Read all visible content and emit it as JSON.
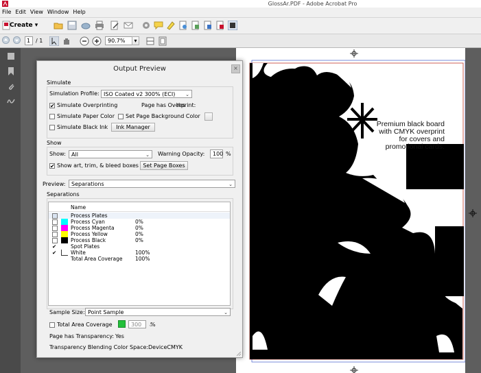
{
  "window": {
    "title": "GlossAr.PDF - Adobe Acrobat Pro"
  },
  "menu": [
    "File",
    "Edit",
    "View",
    "Window",
    "Help"
  ],
  "toolbar": {
    "create_label": "Create",
    "page_current": "1",
    "page_total": "/ 1",
    "zoom_value": "90.7%"
  },
  "document": {
    "text": "Premium black board\nwith CMYK overprint\nfor covers and\npromotional cards."
  },
  "dialog": {
    "title": "Output Preview",
    "close_symbol": "×",
    "simulate": {
      "group_label": "Simulate",
      "profile_label": "Simulation Profile:",
      "profile_value": "ISO Coated v2 300% (ECI)",
      "overprinting_label": "Simulate Overprinting",
      "page_has_overprint_label": "Page has Overprint:",
      "page_has_overprint_value": "Yes",
      "paper_color_label": "Simulate Paper Color",
      "bg_color_label": "Set Page Background Color",
      "black_ink_label": "Simulate Black Ink",
      "ink_manager_label": "Ink Manager"
    },
    "show": {
      "group_label": "Show",
      "show_label": "Show:",
      "show_value": "All",
      "warning_opacity_label": "Warning Opacity:",
      "warning_opacity_value": "100",
      "percent": "%",
      "boxes_label": "Show art, trim, & bleed boxes",
      "set_page_boxes_label": "Set Page Boxes"
    },
    "preview": {
      "label": "Preview:",
      "value": "Separations"
    },
    "separations": {
      "group_label": "Separations",
      "column_name": "Name",
      "rows": [
        {
          "check": "",
          "name": "Process Plates",
          "pct": "",
          "color": ""
        },
        {
          "check": "",
          "name": "Process Cyan",
          "pct": "0%",
          "color": "#00ffff"
        },
        {
          "check": "",
          "name": "Process Magenta",
          "pct": "0%",
          "color": "#ff00ff"
        },
        {
          "check": "",
          "name": "Process Yellow",
          "pct": "0%",
          "color": "#ffff00"
        },
        {
          "check": "",
          "name": "Process Black",
          "pct": "0%",
          "color": "#000000"
        },
        {
          "check": "✔",
          "name": "Spot Plates",
          "pct": "",
          "color": ""
        },
        {
          "check": "✔",
          "name": "White",
          "pct": "100%",
          "color": "#ffffff"
        },
        {
          "check": "",
          "name": "Total Area Coverage",
          "pct": "100%",
          "color": ""
        }
      ]
    },
    "sample_size": {
      "label": "Sample Size:",
      "value": "Point Sample"
    },
    "tac": {
      "label": "Total Area Coverage",
      "value": "300",
      "percent": "%"
    },
    "transparency": {
      "label": "Page has Transparency:",
      "value": "Yes",
      "blend_label": "Transparency Blending Color Space:",
      "blend_value": "DeviceCMYK"
    }
  },
  "colors": {
    "swatch_green": "#22c03a"
  }
}
